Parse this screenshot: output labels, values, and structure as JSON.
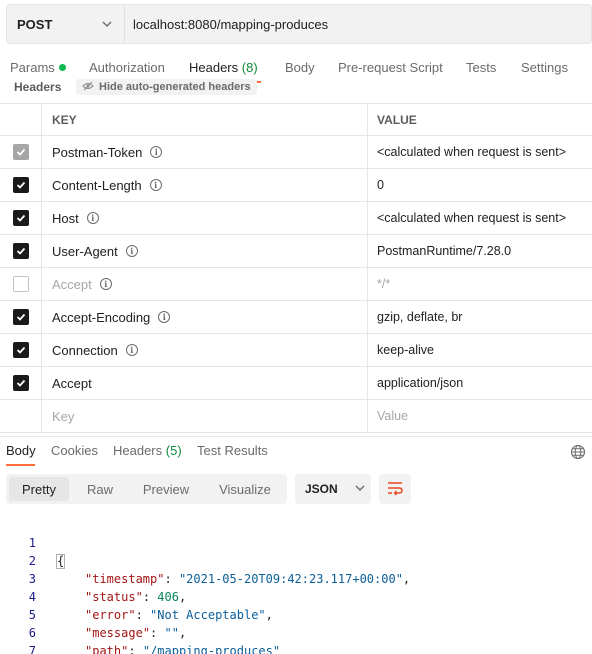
{
  "request": {
    "method": "POST",
    "url": "localhost:8080/mapping-produces"
  },
  "req_tabs": [
    {
      "label": "Params",
      "dot": true
    },
    {
      "label": "Authorization"
    },
    {
      "label": "Headers",
      "count": "(8)",
      "active": true
    },
    {
      "label": "Body"
    },
    {
      "label": "Pre-request Script"
    },
    {
      "label": "Tests"
    },
    {
      "label": "Settings"
    }
  ],
  "headers_section": {
    "title": "Headers",
    "hide_auto": "Hide auto-generated headers",
    "col_key": "KEY",
    "col_value": "VALUE",
    "rows": [
      {
        "key": "Postman-Token",
        "value": "<calculated when request is sent>",
        "state": "auto",
        "info": true
      },
      {
        "key": "Content-Length",
        "value": "0",
        "state": "checked",
        "info": true
      },
      {
        "key": "Host",
        "value": "<calculated when request is sent>",
        "state": "checked",
        "info": true
      },
      {
        "key": "User-Agent",
        "value": "PostmanRuntime/7.28.0",
        "state": "checked",
        "info": true
      },
      {
        "key": "Accept",
        "value": "*/*",
        "state": "unchecked",
        "info": true
      },
      {
        "key": "Accept-Encoding",
        "value": "gzip, deflate, br",
        "state": "checked",
        "info": true
      },
      {
        "key": "Connection",
        "value": "keep-alive",
        "state": "checked",
        "info": true
      },
      {
        "key": "Accept",
        "value": "application/json",
        "state": "checked",
        "info": false
      }
    ],
    "key_placeholder": "Key",
    "value_placeholder": "Value"
  },
  "resp_tabs": [
    {
      "label": "Body",
      "active": true
    },
    {
      "label": "Cookies"
    },
    {
      "label": "Headers",
      "count": "(5)"
    },
    {
      "label": "Test Results"
    }
  ],
  "view_modes": [
    "Pretty",
    "Raw",
    "Preview",
    "Visualize"
  ],
  "format": "JSON",
  "response_lines": [
    {
      "n": "1",
      "text": "{"
    },
    {
      "n": "2",
      "key": "timestamp",
      "value": "\"2021-05-20T09:42:23.117+00:00\"",
      "type": "s"
    },
    {
      "n": "3",
      "key": "status",
      "value": "406",
      "type": "n"
    },
    {
      "n": "4",
      "key": "error",
      "value": "\"Not Acceptable\"",
      "type": "s"
    },
    {
      "n": "5",
      "key": "message",
      "value": "\"\"",
      "type": "s"
    },
    {
      "n": "6",
      "key": "path",
      "value": "/mapping-produces",
      "type": "link"
    },
    {
      "n": "7",
      "text": "}"
    }
  ],
  "colors": {
    "accent": "#ff6c37",
    "success": "#0cbb52",
    "count": "#0f8a3a"
  }
}
